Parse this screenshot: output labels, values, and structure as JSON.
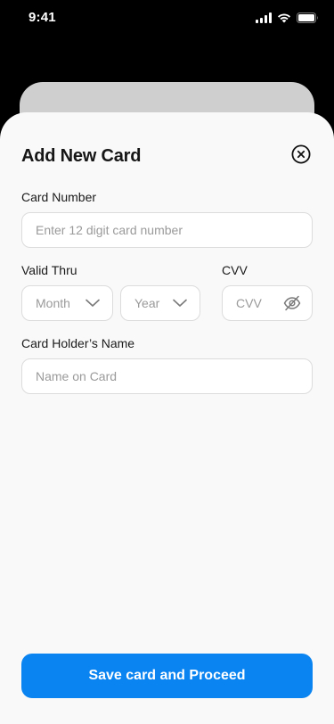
{
  "status_bar": {
    "time": "9:41",
    "icons": [
      "signal-icon",
      "wifi-icon",
      "battery-icon"
    ]
  },
  "sheet": {
    "title": "Add New Card",
    "close_icon": "close-circle-icon"
  },
  "form": {
    "card_number": {
      "label": "Card Number",
      "placeholder": "Enter 12 digit card number",
      "value": ""
    },
    "valid_thru": {
      "label": "Valid Thru",
      "month_placeholder": "Month",
      "year_placeholder": "Year"
    },
    "cvv": {
      "label": "CVV",
      "placeholder": "CVV",
      "visibility_icon": "eye-off-icon"
    },
    "holder_name": {
      "label": "Card Holder’s Name",
      "placeholder": "Name on Card",
      "value": ""
    }
  },
  "actions": {
    "submit_label": "Save card and Proceed"
  },
  "colors": {
    "accent": "#0a84f0",
    "sheet_bg": "#f9f9f9",
    "border": "#dcdcdc",
    "placeholder": "#9a9a9a"
  }
}
